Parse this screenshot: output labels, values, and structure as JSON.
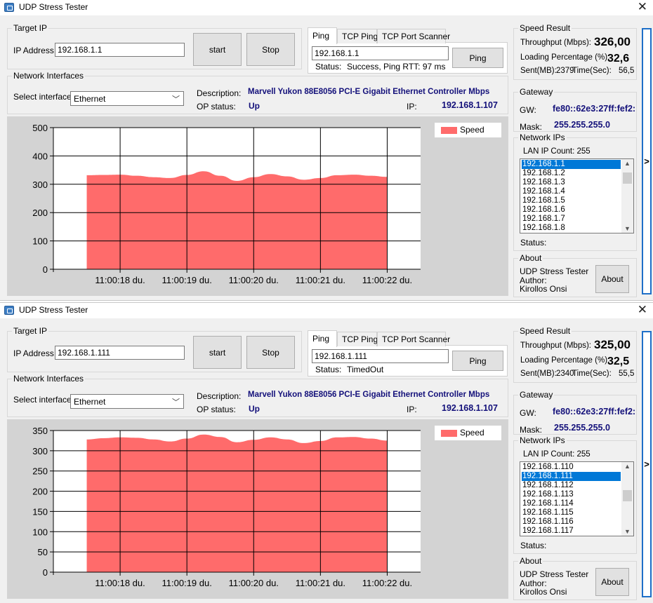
{
  "windows": [
    {
      "title": "UDP Stress Tester",
      "target_ip": {
        "legend": "Target IP",
        "ip_label": "IP Address",
        "ip_value": "192.168.1.1",
        "start_label": "start",
        "stop_label": "Stop"
      },
      "tabs": [
        "Ping",
        "TCP Ping",
        "TCP Port Scanner"
      ],
      "ping": {
        "host": "192.168.1.1",
        "button": "Ping",
        "status_label": "Status:",
        "status_value": "Success, Ping RTT: 97 ms"
      },
      "net": {
        "legend": "Network Interfaces",
        "select_label": "Select interface",
        "selected": "Ethernet",
        "desc_label": "Description:",
        "desc_value": "Marvell Yukon 88E8056 PCI-E Gigabit Ethernet Controller Mbps",
        "op_label": "OP status:",
        "op_value": "Up",
        "ip_label": "IP:",
        "ip_value": "192.168.1.107"
      },
      "speed": {
        "legend": "Speed Result",
        "throughput_label": "Throughput (Mbps):",
        "throughput_value": "326,00",
        "loading_label": "Loading Percentage (%):",
        "loading_value": "32,6",
        "sent_label": "Sent(MB):",
        "sent_value": "2379",
        "time_label": "Time(Sec):",
        "time_value": "56,5"
      },
      "gateway": {
        "legend": "Gateway",
        "gw_label": "GW:",
        "gw_value": "fe80::62e3:27ff:fef2:",
        "mask_label": "Mask:",
        "mask_value": "255.255.255.0"
      },
      "netips": {
        "legend": "Network IPs",
        "count_label": "LAN IP Count: 255",
        "items": [
          "192.168.1.1",
          "192.168.1.2",
          "192.168.1.3",
          "192.168.1.4",
          "192.168.1.5",
          "192.168.1.6",
          "192.168.1.7",
          "192.168.1.8"
        ],
        "selected_index": 0,
        "status_label": "Status:"
      },
      "about": {
        "legend": "About",
        "line1": "UDP Stress Tester",
        "line2": "Author:",
        "line3": "Kirollos Onsi",
        "button": "About"
      },
      "side_toggle": ">",
      "chart_data": {
        "type": "area",
        "series": [
          {
            "name": "Speed",
            "color": "#ff6b6b",
            "x": [
              0,
              0.5,
              1,
              1.5,
              2,
              2.5,
              3,
              3.5,
              4,
              4.5,
              5,
              5.5,
              6,
              6.5,
              7,
              7.5,
              8,
              8.5,
              9
            ],
            "values": [
              332,
              333,
              334,
              330,
              325,
              322,
              333,
              346,
              330,
              312,
              325,
              336,
              328,
              316,
              322,
              332,
              334,
              330,
              326
            ]
          }
        ],
        "x_tick_positions": [
          1,
          3,
          5,
          7,
          9
        ],
        "x_ticks": [
          "11:00:18 du.",
          "11:00:19 du.",
          "11:00:20 du.",
          "11:00:21 du.",
          "11:00:22 du."
        ],
        "xlim": [
          -1,
          10
        ],
        "ylim": [
          0,
          500
        ],
        "y_ticks": [
          0,
          100,
          200,
          300,
          400,
          500
        ],
        "grid": true,
        "legend_position": "top-right"
      }
    },
    {
      "title": "UDP Stress Tester",
      "target_ip": {
        "legend": "Target IP",
        "ip_label": "IP Address",
        "ip_value": "192.168.1.111",
        "start_label": "start",
        "stop_label": "Stop"
      },
      "tabs": [
        "Ping",
        "TCP Ping",
        "TCP Port Scanner"
      ],
      "ping": {
        "host": "192.168.1.111",
        "button": "Ping",
        "status_label": "Status:",
        "status_value": "TimedOut"
      },
      "net": {
        "legend": "Network Interfaces",
        "select_label": "Select interface",
        "selected": "Ethernet",
        "desc_label": "Description:",
        "desc_value": "Marvell Yukon 88E8056 PCI-E Gigabit Ethernet Controller Mbps",
        "op_label": "OP status:",
        "op_value": "Up",
        "ip_label": "IP:",
        "ip_value": "192.168.1.107"
      },
      "speed": {
        "legend": "Speed Result",
        "throughput_label": "Throughput (Mbps):",
        "throughput_value": "325,00",
        "loading_label": "Loading Percentage (%):",
        "loading_value": "32,5",
        "sent_label": "Sent(MB):",
        "sent_value": "2340",
        "time_label": "Time(Sec):",
        "time_value": "55,5"
      },
      "gateway": {
        "legend": "Gateway",
        "gw_label": "GW:",
        "gw_value": "fe80::62e3:27ff:fef2:",
        "mask_label": "Mask:",
        "mask_value": "255.255.255.0"
      },
      "netips": {
        "legend": "Network IPs",
        "count_label": "LAN IP Count: 255",
        "items": [
          "192.168.1.110",
          "192.168.1.111",
          "192.168.1.112",
          "192.168.1.113",
          "192.168.1.114",
          "192.168.1.115",
          "192.168.1.116",
          "192.168.1.117"
        ],
        "selected_index": 1,
        "status_label": "Status:"
      },
      "about": {
        "legend": "About",
        "line1": "UDP Stress Tester",
        "line2": "Author:",
        "line3": "Kirollos Onsi",
        "button": "About"
      },
      "side_toggle": ">",
      "chart_data": {
        "type": "area",
        "series": [
          {
            "name": "Speed",
            "color": "#ff6b6b",
            "x": [
              0,
              0.5,
              1,
              1.5,
              2,
              2.5,
              3,
              3.5,
              4,
              4.5,
              5,
              5.5,
              6,
              6.5,
              7,
              7.5,
              8,
              8.5,
              9
            ],
            "values": [
              328,
              331,
              333,
              332,
              328,
              323,
              330,
              340,
              334,
              321,
              327,
              333,
              328,
              319,
              324,
              333,
              334,
              330,
              325
            ]
          }
        ],
        "x_tick_positions": [
          1,
          3,
          5,
          7,
          9
        ],
        "x_ticks": [
          "11:00:18 du.",
          "11:00:19 du.",
          "11:00:20 du.",
          "11:00:21 du.",
          "11:00:22 du."
        ],
        "xlim": [
          -1,
          10
        ],
        "ylim": [
          0,
          350
        ],
        "y_ticks": [
          0,
          50,
          100,
          150,
          200,
          250,
          300,
          350
        ],
        "grid": true,
        "legend_position": "top-right"
      }
    }
  ]
}
